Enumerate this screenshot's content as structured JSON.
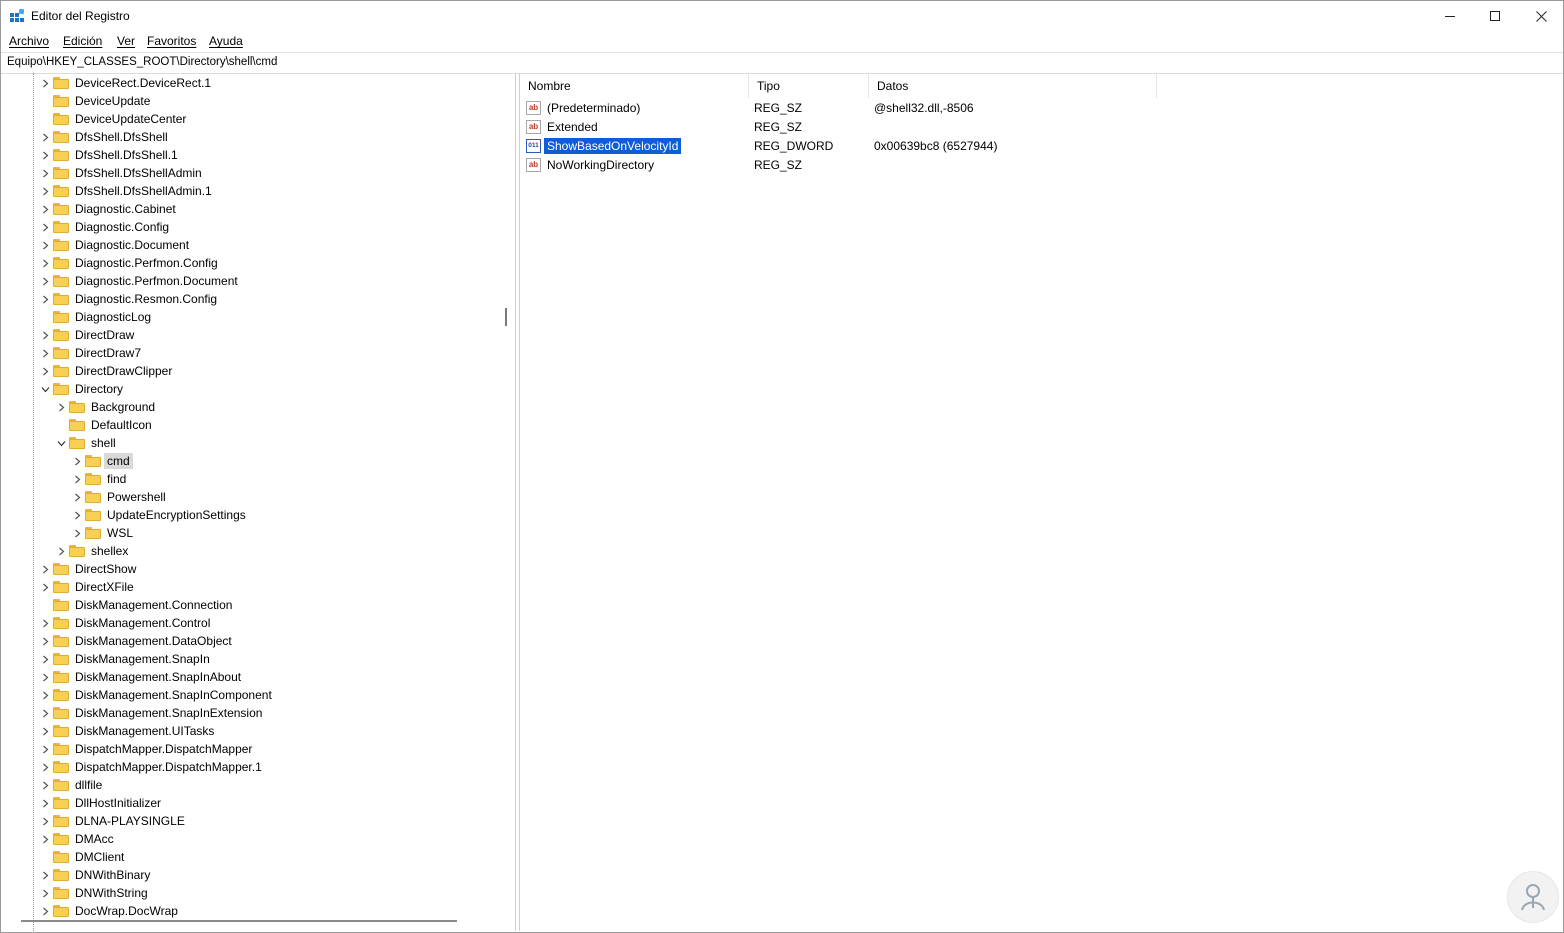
{
  "window": {
    "title": "Editor del Registro"
  },
  "menu": [
    "Archivo",
    "Edición",
    "Ver",
    "Favoritos",
    "Ayuda"
  ],
  "address": "Equipo\\HKEY_CLASSES_ROOT\\Directory\\shell\\cmd",
  "tree": [
    {
      "label": "DeviceRect.DeviceRect.1",
      "level": 0,
      "expander": "collapsed"
    },
    {
      "label": "DeviceUpdate",
      "level": 0,
      "expander": "none"
    },
    {
      "label": "DeviceUpdateCenter",
      "level": 0,
      "expander": "none"
    },
    {
      "label": "DfsShell.DfsShell",
      "level": 0,
      "expander": "collapsed"
    },
    {
      "label": "DfsShell.DfsShell.1",
      "level": 0,
      "expander": "collapsed"
    },
    {
      "label": "DfsShell.DfsShellAdmin",
      "level": 0,
      "expander": "collapsed"
    },
    {
      "label": "DfsShell.DfsShellAdmin.1",
      "level": 0,
      "expander": "collapsed"
    },
    {
      "label": "Diagnostic.Cabinet",
      "level": 0,
      "expander": "collapsed"
    },
    {
      "label": "Diagnostic.Config",
      "level": 0,
      "expander": "collapsed"
    },
    {
      "label": "Diagnostic.Document",
      "level": 0,
      "expander": "collapsed"
    },
    {
      "label": "Diagnostic.Perfmon.Config",
      "level": 0,
      "expander": "collapsed"
    },
    {
      "label": "Diagnostic.Perfmon.Document",
      "level": 0,
      "expander": "collapsed"
    },
    {
      "label": "Diagnostic.Resmon.Config",
      "level": 0,
      "expander": "collapsed"
    },
    {
      "label": "DiagnosticLog",
      "level": 0,
      "expander": "none"
    },
    {
      "label": "DirectDraw",
      "level": 0,
      "expander": "collapsed"
    },
    {
      "label": "DirectDraw7",
      "level": 0,
      "expander": "collapsed"
    },
    {
      "label": "DirectDrawClipper",
      "level": 0,
      "expander": "collapsed"
    },
    {
      "label": "Directory",
      "level": 0,
      "expander": "expanded"
    },
    {
      "label": "Background",
      "level": 1,
      "expander": "collapsed"
    },
    {
      "label": "DefaultIcon",
      "level": 1,
      "expander": "none"
    },
    {
      "label": "shell",
      "level": 1,
      "expander": "expanded"
    },
    {
      "label": "cmd",
      "level": 2,
      "expander": "collapsed",
      "selected": true
    },
    {
      "label": "find",
      "level": 2,
      "expander": "collapsed"
    },
    {
      "label": "Powershell",
      "level": 2,
      "expander": "collapsed"
    },
    {
      "label": "UpdateEncryptionSettings",
      "level": 2,
      "expander": "collapsed"
    },
    {
      "label": "WSL",
      "level": 2,
      "expander": "collapsed"
    },
    {
      "label": "shellex",
      "level": 1,
      "expander": "collapsed"
    },
    {
      "label": "DirectShow",
      "level": 0,
      "expander": "collapsed"
    },
    {
      "label": "DirectXFile",
      "level": 0,
      "expander": "collapsed"
    },
    {
      "label": "DiskManagement.Connection",
      "level": 0,
      "expander": "none"
    },
    {
      "label": "DiskManagement.Control",
      "level": 0,
      "expander": "collapsed"
    },
    {
      "label": "DiskManagement.DataObject",
      "level": 0,
      "expander": "collapsed"
    },
    {
      "label": "DiskManagement.SnapIn",
      "level": 0,
      "expander": "collapsed"
    },
    {
      "label": "DiskManagement.SnapInAbout",
      "level": 0,
      "expander": "collapsed"
    },
    {
      "label": "DiskManagement.SnapInComponent",
      "level": 0,
      "expander": "collapsed"
    },
    {
      "label": "DiskManagement.SnapInExtension",
      "level": 0,
      "expander": "collapsed"
    },
    {
      "label": "DiskManagement.UITasks",
      "level": 0,
      "expander": "collapsed"
    },
    {
      "label": "DispatchMapper.DispatchMapper",
      "level": 0,
      "expander": "collapsed"
    },
    {
      "label": "DispatchMapper.DispatchMapper.1",
      "level": 0,
      "expander": "collapsed"
    },
    {
      "label": "dllfile",
      "level": 0,
      "expander": "collapsed"
    },
    {
      "label": "DllHostInitializer",
      "level": 0,
      "expander": "collapsed"
    },
    {
      "label": "DLNA-PLAYSINGLE",
      "level": 0,
      "expander": "collapsed"
    },
    {
      "label": "DMAcc",
      "level": 0,
      "expander": "collapsed"
    },
    {
      "label": "DMClient",
      "level": 0,
      "expander": "none"
    },
    {
      "label": "DNWithBinary",
      "level": 0,
      "expander": "collapsed"
    },
    {
      "label": "DNWithString",
      "level": 0,
      "expander": "collapsed"
    },
    {
      "label": "DocWrap.DocWrap",
      "level": 0,
      "expander": "collapsed"
    }
  ],
  "columns": {
    "name": "Nombre",
    "type": "Tipo",
    "data": "Datos"
  },
  "values": [
    {
      "name": "(Predeterminado)",
      "type": "REG_SZ",
      "data": "@shell32.dll,-8506",
      "icon": "string-value-icon"
    },
    {
      "name": "Extended",
      "type": "REG_SZ",
      "data": "",
      "icon": "string-value-icon"
    },
    {
      "name": "ShowBasedOnVelocityId",
      "type": "REG_DWORD",
      "data": "0x00639bc8 (6527944)",
      "icon": "binary-value-icon",
      "selected": true
    },
    {
      "name": "NoWorkingDirectory",
      "type": "REG_SZ",
      "data": "",
      "icon": "string-value-icon"
    }
  ],
  "icon_glyphs": {
    "string": "ab",
    "binary": "011"
  },
  "colors": {
    "folder": "#f7cf55",
    "selection": "#0a5fd8",
    "tree_selection": "#d9d9d9"
  }
}
